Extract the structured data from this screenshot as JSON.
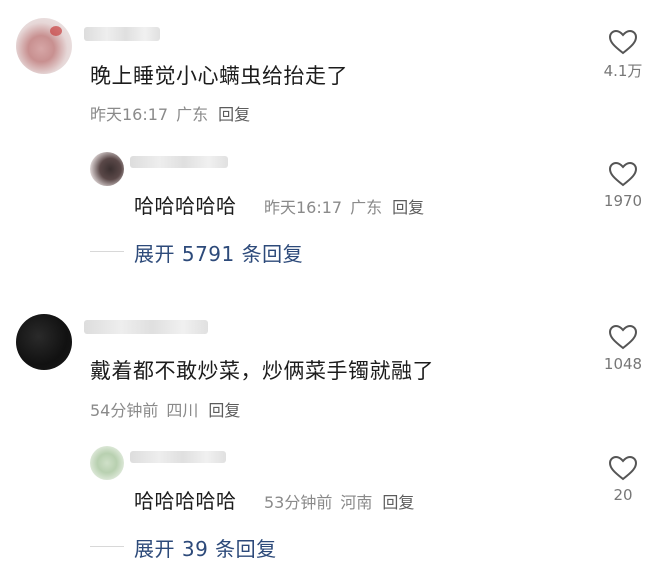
{
  "comments": [
    {
      "text": "晚上睡觉小心螨虫给抬走了",
      "time": "昨天16:17",
      "location": "广东",
      "reply_label": "回复",
      "likes": "4.1万",
      "reply": {
        "text": "哈哈哈哈哈",
        "time": "昨天16:17",
        "location": "广东",
        "reply_label": "回复",
        "likes": "1970"
      },
      "expand_label": "展开 5791 条回复"
    },
    {
      "text": "戴着都不敢炒菜，炒俩菜手镯就融了",
      "time": "54分钟前",
      "location": "四川",
      "reply_label": "回复",
      "likes": "1048",
      "reply": {
        "text": "哈哈哈哈哈",
        "time": "53分钟前",
        "location": "河南",
        "reply_label": "回复",
        "likes": "20"
      },
      "expand_label": "展开 39 条回复"
    }
  ],
  "icons": {
    "like": "heart-outline-icon"
  },
  "colors": {
    "text": "#1c1c1c",
    "meta": "#8a8a8a",
    "expand": "#2d4a7a",
    "icon": "#555555"
  }
}
